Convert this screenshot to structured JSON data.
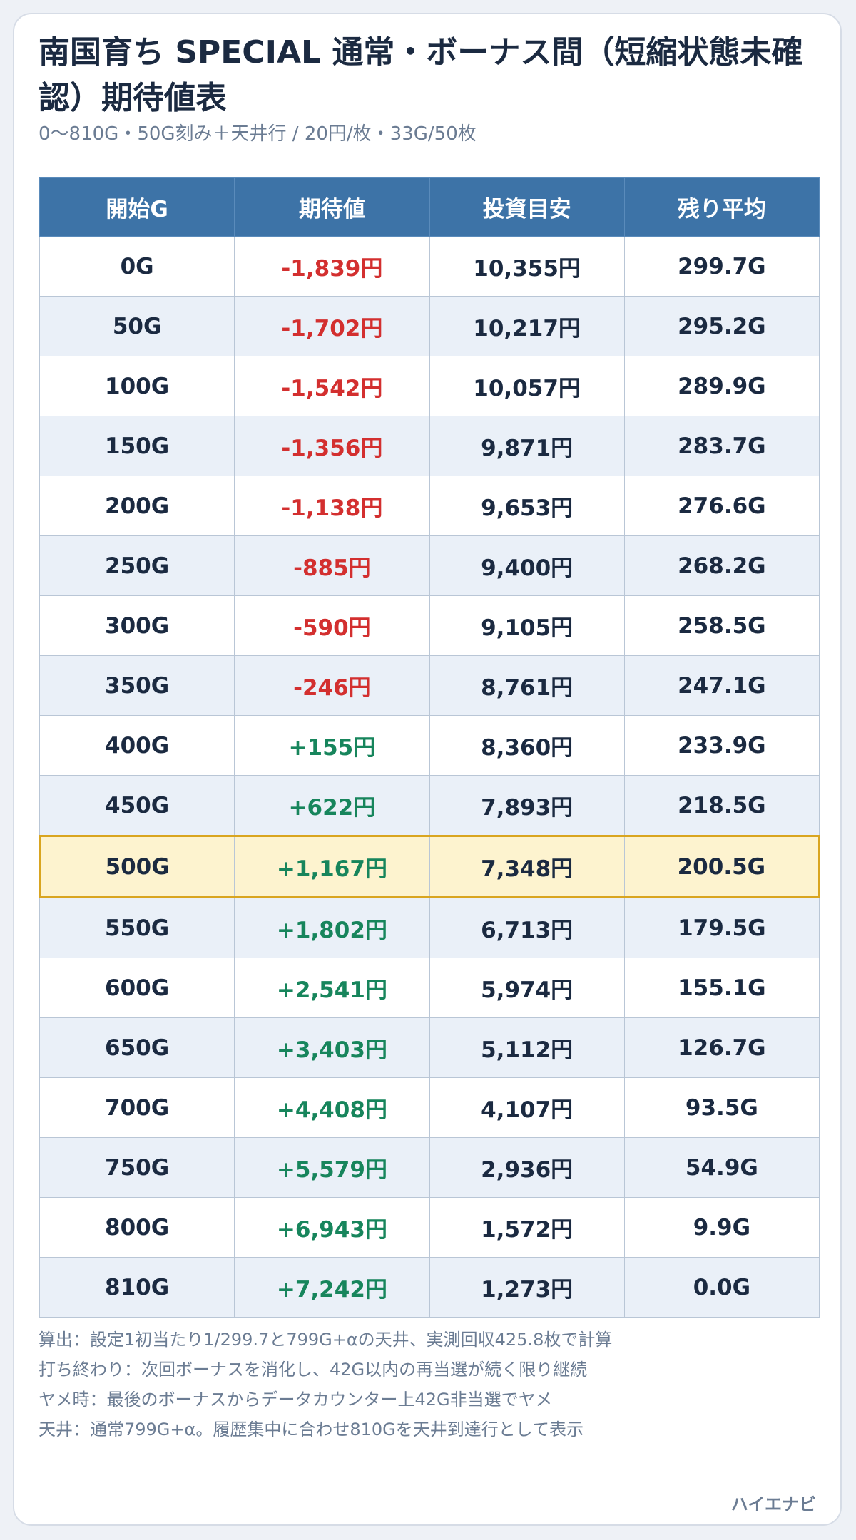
{
  "title": "南国育ち SPECIAL 通常・ボーナス間（短縮状態未確認）期待値表",
  "subtitle": "0〜810G・50G刻み＋天井行 / 20円/枚・33G/50枚",
  "table": {
    "headers": [
      "開始G",
      "期待値",
      "投資目安",
      "残り平均"
    ],
    "highlight_row": "500G",
    "rows": [
      {
        "start": "0G",
        "ev": "-1,839円",
        "sign": "neg",
        "invest": "10,355円",
        "remain": "299.7G"
      },
      {
        "start": "50G",
        "ev": "-1,702円",
        "sign": "neg",
        "invest": "10,217円",
        "remain": "295.2G"
      },
      {
        "start": "100G",
        "ev": "-1,542円",
        "sign": "neg",
        "invest": "10,057円",
        "remain": "289.9G"
      },
      {
        "start": "150G",
        "ev": "-1,356円",
        "sign": "neg",
        "invest": "9,871円",
        "remain": "283.7G"
      },
      {
        "start": "200G",
        "ev": "-1,138円",
        "sign": "neg",
        "invest": "9,653円",
        "remain": "276.6G"
      },
      {
        "start": "250G",
        "ev": "-885円",
        "sign": "neg",
        "invest": "9,400円",
        "remain": "268.2G"
      },
      {
        "start": "300G",
        "ev": "-590円",
        "sign": "neg",
        "invest": "9,105円",
        "remain": "258.5G"
      },
      {
        "start": "350G",
        "ev": "-246円",
        "sign": "neg",
        "invest": "8,761円",
        "remain": "247.1G"
      },
      {
        "start": "400G",
        "ev": "+155円",
        "sign": "pos",
        "invest": "8,360円",
        "remain": "233.9G"
      },
      {
        "start": "450G",
        "ev": "+622円",
        "sign": "pos",
        "invest": "7,893円",
        "remain": "218.5G"
      },
      {
        "start": "500G",
        "ev": "+1,167円",
        "sign": "pos",
        "invest": "7,348円",
        "remain": "200.5G"
      },
      {
        "start": "550G",
        "ev": "+1,802円",
        "sign": "pos",
        "invest": "6,713円",
        "remain": "179.5G"
      },
      {
        "start": "600G",
        "ev": "+2,541円",
        "sign": "pos",
        "invest": "5,974円",
        "remain": "155.1G"
      },
      {
        "start": "650G",
        "ev": "+3,403円",
        "sign": "pos",
        "invest": "5,112円",
        "remain": "126.7G"
      },
      {
        "start": "700G",
        "ev": "+4,408円",
        "sign": "pos",
        "invest": "4,107円",
        "remain": "93.5G"
      },
      {
        "start": "750G",
        "ev": "+5,579円",
        "sign": "pos",
        "invest": "2,936円",
        "remain": "54.9G"
      },
      {
        "start": "800G",
        "ev": "+6,943円",
        "sign": "pos",
        "invest": "1,572円",
        "remain": "9.9G"
      },
      {
        "start": "810G",
        "ev": "+7,242円",
        "sign": "pos",
        "invest": "1,273円",
        "remain": "0.0G"
      }
    ]
  },
  "notes": [
    "算出：設定1初当たり1/299.7と799G+αの天井、実測回収425.8枚で計算",
    "打ち終わり：次回ボーナスを消化し、42G以内の再当選が続く限り継続",
    "ヤメ時：最後のボーナスからデータカウンター上42G非当選でヤメ",
    "天井：通常799G+α。履歴集中に合わせ810Gを天井到達行として表示"
  ],
  "brand": "ハイエナビ",
  "colors": {
    "header_bg": "#3d73a7",
    "negative": "#d32f2f",
    "positive": "#17855c",
    "highlight_bg": "#fdf3cf",
    "highlight_border": "#d9a520",
    "stripe": "#eaf0f8"
  }
}
